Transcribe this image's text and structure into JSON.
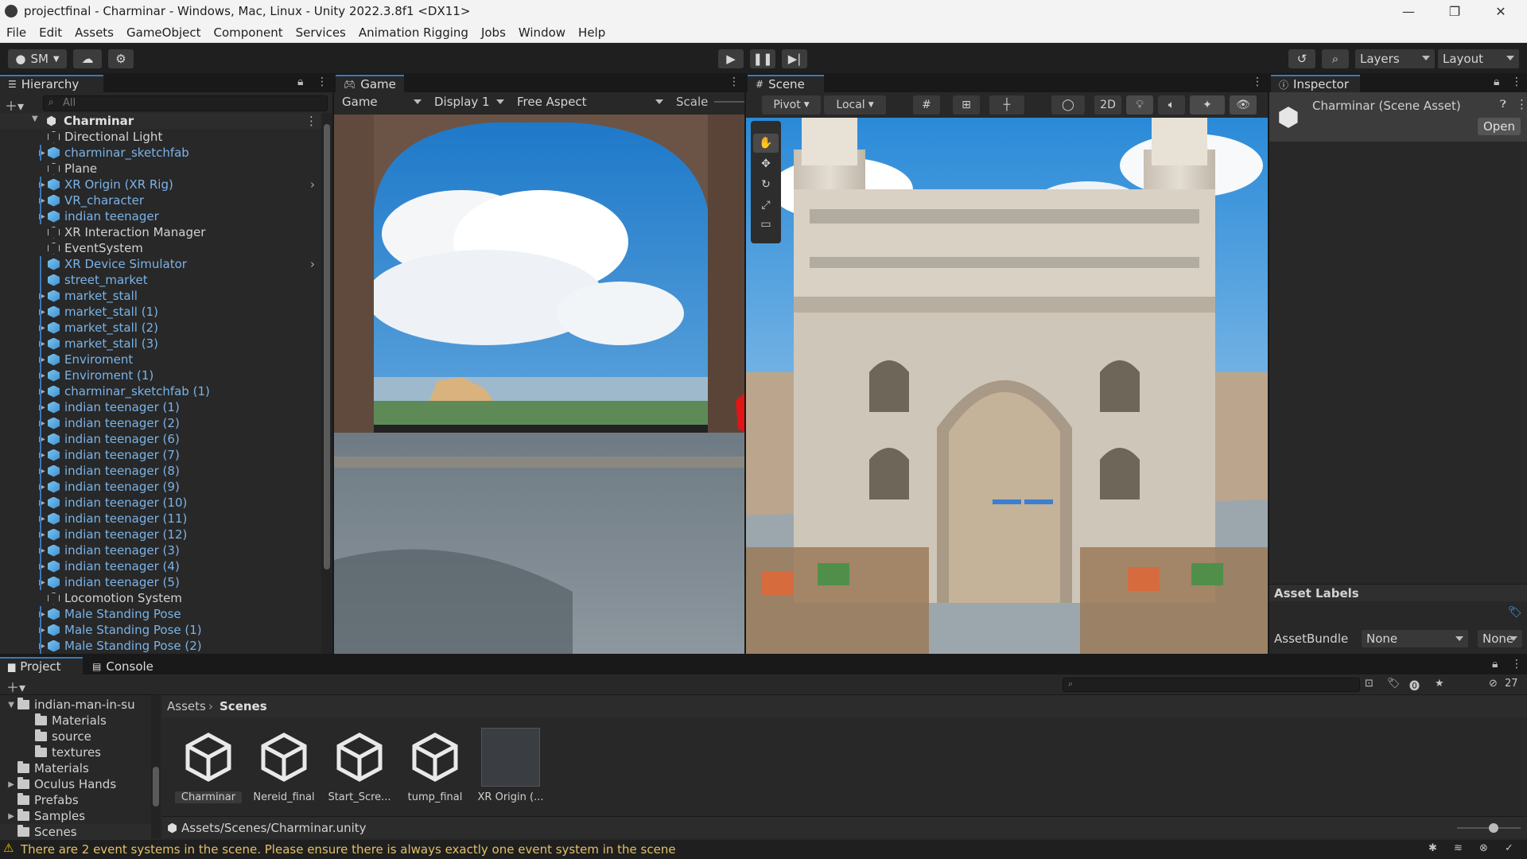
{
  "window": {
    "title": "projectfinal - Charminar - Windows, Mac, Linux - Unity 2022.3.8f1 <DX11>",
    "controls": [
      "—",
      "❐",
      "✕"
    ]
  },
  "menu": [
    "File",
    "Edit",
    "Assets",
    "GameObject",
    "Component",
    "Services",
    "Animation Rigging",
    "Jobs",
    "Window",
    "Help"
  ],
  "toolbar": {
    "account": "SM",
    "layers": "Layers",
    "layout": "Layout"
  },
  "hierarchy": {
    "tab": "Hierarchy",
    "search_placeholder": "All",
    "scene": "Charminar",
    "items": [
      {
        "label": "Directional Light",
        "prefab": false,
        "expand": false
      },
      {
        "label": "charminar_sketchfab",
        "prefab": true,
        "expand": true
      },
      {
        "label": "Plane",
        "prefab": false,
        "expand": false
      },
      {
        "label": "XR Origin (XR Rig)",
        "prefab": true,
        "expand": true
      },
      {
        "label": "VR_character",
        "prefab": true,
        "expand": true
      },
      {
        "label": "indian teenager",
        "prefab": true,
        "expand": true
      },
      {
        "label": "XR Interaction Manager",
        "prefab": false,
        "expand": false
      },
      {
        "label": "EventSystem",
        "prefab": false,
        "expand": false
      },
      {
        "label": "XR Device Simulator",
        "prefab": true,
        "expand": false
      },
      {
        "label": "street_market",
        "prefab": true,
        "expand": false
      },
      {
        "label": "market_stall",
        "prefab": true,
        "expand": true
      },
      {
        "label": "market_stall (1)",
        "prefab": true,
        "expand": true
      },
      {
        "label": "market_stall (2)",
        "prefab": true,
        "expand": true
      },
      {
        "label": "market_stall (3)",
        "prefab": true,
        "expand": true
      },
      {
        "label": "Enviroment",
        "prefab": true,
        "expand": true
      },
      {
        "label": "Enviroment (1)",
        "prefab": true,
        "expand": true
      },
      {
        "label": "charminar_sketchfab (1)",
        "prefab": true,
        "expand": true
      },
      {
        "label": "indian teenager (1)",
        "prefab": true,
        "expand": true
      },
      {
        "label": "indian teenager (2)",
        "prefab": true,
        "expand": true
      },
      {
        "label": "indian teenager (6)",
        "prefab": true,
        "expand": true
      },
      {
        "label": "indian teenager (7)",
        "prefab": true,
        "expand": true
      },
      {
        "label": "indian teenager (8)",
        "prefab": true,
        "expand": true
      },
      {
        "label": "indian teenager (9)",
        "prefab": true,
        "expand": true
      },
      {
        "label": "indian teenager (10)",
        "prefab": true,
        "expand": true
      },
      {
        "label": "indian teenager (11)",
        "prefab": true,
        "expand": true
      },
      {
        "label": "indian teenager (12)",
        "prefab": true,
        "expand": true
      },
      {
        "label": "indian teenager (3)",
        "prefab": true,
        "expand": true
      },
      {
        "label": "indian teenager (4)",
        "prefab": true,
        "expand": true
      },
      {
        "label": "indian teenager (5)",
        "prefab": true,
        "expand": true
      },
      {
        "label": "Locomotion System",
        "prefab": false,
        "expand": false
      },
      {
        "label": "Male Standing Pose",
        "prefab": true,
        "expand": true
      },
      {
        "label": "Male Standing Pose (1)",
        "prefab": true,
        "expand": true
      },
      {
        "label": "Male Standing Pose (2)",
        "prefab": true,
        "expand": true
      }
    ]
  },
  "game": {
    "tab": "Game",
    "mode": "Game",
    "display": "Display 1",
    "aspect": "Free Aspect",
    "scale_label": "Scale"
  },
  "scene": {
    "tab": "Scene",
    "pivot": "Pivot",
    "local": "Local",
    "twod": "2D"
  },
  "inspector": {
    "tab": "Inspector",
    "title": "Charminar (Scene Asset)",
    "open": "Open",
    "asset_labels": "Asset Labels",
    "assetbundle_label": "AssetBundle",
    "assetbundle_value": "None",
    "assetbundle_variant": "None"
  },
  "project": {
    "tab": "Project",
    "console_tab": "Console",
    "hidden_count": "27",
    "breadcrumb": [
      "Assets",
      "Scenes"
    ],
    "tree": [
      {
        "label": "indian-man-in-su",
        "depth": 1,
        "arrow": "▼"
      },
      {
        "label": "Materials",
        "depth": 2,
        "arrow": ""
      },
      {
        "label": "source",
        "depth": 2,
        "arrow": ""
      },
      {
        "label": "textures",
        "depth": 2,
        "arrow": ""
      },
      {
        "label": "Materials",
        "depth": 1,
        "arrow": ""
      },
      {
        "label": "Oculus Hands",
        "depth": 1,
        "arrow": "▶"
      },
      {
        "label": "Prefabs",
        "depth": 1,
        "arrow": ""
      },
      {
        "label": "Samples",
        "depth": 1,
        "arrow": "▶"
      },
      {
        "label": "Scenes",
        "depth": 1,
        "arrow": ""
      }
    ],
    "assets": [
      {
        "label": "Charminar",
        "kind": "scene",
        "selected": true
      },
      {
        "label": "Nereid_final",
        "kind": "scene",
        "selected": false
      },
      {
        "label": "Start_Scre...",
        "kind": "scene",
        "selected": false
      },
      {
        "label": "tump_final",
        "kind": "scene",
        "selected": false
      },
      {
        "label": "XR Origin (...",
        "kind": "prefab",
        "selected": false
      }
    ],
    "path": "Assets/Scenes/Charminar.unity"
  },
  "status": {
    "message": "There are 2 event systems in the scene. Please ensure there is always exactly one event system in the scene"
  }
}
